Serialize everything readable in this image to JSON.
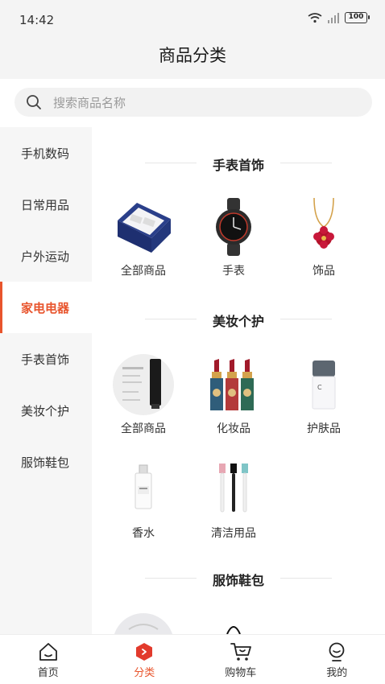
{
  "status": {
    "time": "14:42",
    "battery": "100"
  },
  "header": {
    "title": "商品分类"
  },
  "search": {
    "placeholder": "搜索商品名称"
  },
  "sidebar": {
    "items": [
      {
        "label": "手机数码"
      },
      {
        "label": "日常用品"
      },
      {
        "label": "户外运动"
      },
      {
        "label": "家电电器",
        "active": true
      },
      {
        "label": "手表首饰"
      },
      {
        "label": "美妆个护"
      },
      {
        "label": "服饰鞋包"
      }
    ]
  },
  "sections": [
    {
      "title": "手表首饰",
      "items": [
        {
          "label": "全部商品"
        },
        {
          "label": "手表"
        },
        {
          "label": "饰品"
        }
      ]
    },
    {
      "title": "美妆个护",
      "items": [
        {
          "label": "全部商品"
        },
        {
          "label": "化妆品"
        },
        {
          "label": "护肤品"
        },
        {
          "label": "香水"
        },
        {
          "label": "清洁用品"
        }
      ]
    },
    {
      "title": "服饰鞋包",
      "items": []
    }
  ],
  "tabbar": {
    "items": [
      {
        "label": "首页",
        "icon": "home-icon"
      },
      {
        "label": "分类",
        "icon": "category-icon",
        "active": true
      },
      {
        "label": "购物车",
        "icon": "cart-icon"
      },
      {
        "label": "我的",
        "icon": "profile-icon"
      }
    ]
  },
  "colors": {
    "accent": "#e8542c",
    "background": "#f4f4f4"
  }
}
